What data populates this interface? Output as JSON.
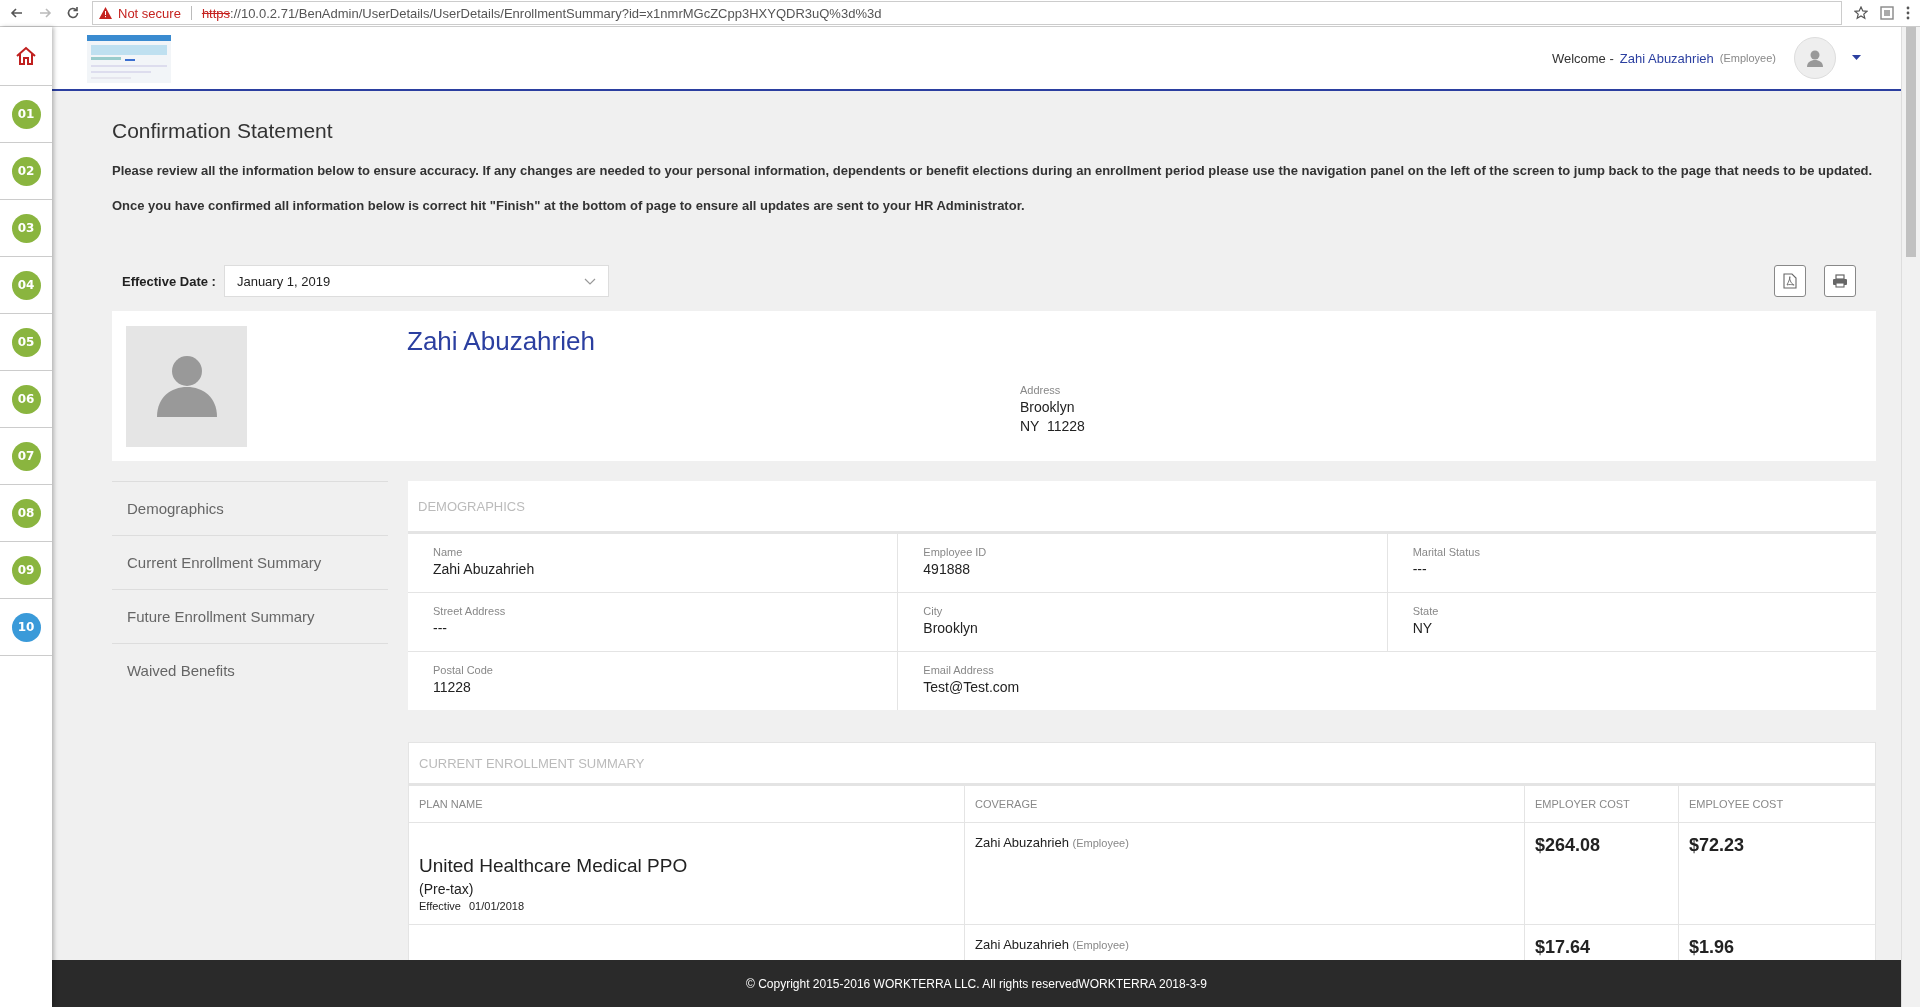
{
  "browser": {
    "security": "Not secure",
    "url_scheme": "https",
    "url_rest": "://10.0.2.71/BenAdmin/UserDetails/UserDetails/EnrollmentSummary?id=x1nmrMGcZCpp3HXYQDR3uQ%3d%3d"
  },
  "header": {
    "welcome": "Welcome -",
    "user": "Zahi Abuzahrieh",
    "role": "(Employee)"
  },
  "steps": [
    {
      "label": "01",
      "selected": false
    },
    {
      "label": "02",
      "selected": false
    },
    {
      "label": "03",
      "selected": false
    },
    {
      "label": "04",
      "selected": false
    },
    {
      "label": "05",
      "selected": false
    },
    {
      "label": "06",
      "selected": false
    },
    {
      "label": "07",
      "selected": false
    },
    {
      "label": "08",
      "selected": false
    },
    {
      "label": "09",
      "selected": false
    },
    {
      "label": "10",
      "selected": true
    }
  ],
  "title": "Confirmation Statement",
  "paragraphs": [
    "Please review all the information below to ensure accuracy.  If any changes are needed to your personal information, dependents or benefit elections during an enrollment period please use the navigation panel on the left of the screen to jump back to the page that needs to be updated.",
    "Once you have confirmed all information below is correct hit \"Finish\" at the bottom of page to ensure all updates are sent to your HR Administrator."
  ],
  "effective_date": {
    "label": "Effective Date :",
    "value": "January 1, 2019"
  },
  "profile": {
    "name": "Zahi Abuzahrieh",
    "address_label": "Address",
    "address_lines": [
      "Brooklyn",
      "NY  11228"
    ]
  },
  "section_menu": [
    {
      "label": "Demographics"
    },
    {
      "label": "Current Enrollment Summary"
    },
    {
      "label": "Future Enrollment Summary"
    },
    {
      "label": "Waived Benefits"
    }
  ],
  "demographics": {
    "title": "DEMOGRAPHICS",
    "rows": [
      [
        {
          "label": "Name",
          "value": "Zahi Abuzahrieh"
        },
        {
          "label": "Employee ID",
          "value": "491888"
        },
        {
          "label": "Marital Status",
          "value": "---"
        }
      ],
      [
        {
          "label": "Street Address",
          "value": "---"
        },
        {
          "label": "City",
          "value": "Brooklyn"
        },
        {
          "label": "State",
          "value": "NY"
        }
      ],
      [
        {
          "label": "Postal Code",
          "value": "11228"
        },
        {
          "label": "Email Address",
          "value": "Test@Test.com"
        }
      ]
    ]
  },
  "enrollment": {
    "title": "CURRENT ENROLLMENT SUMMARY",
    "columns": [
      "PLAN NAME",
      "COVERAGE",
      "EMPLOYER COST",
      "EMPLOYEE COST"
    ],
    "rows": [
      {
        "plan_name": "United Healthcare Medical PPO",
        "tax": "(Pre-tax)",
        "effective_label": "Effective",
        "effective_date": "01/01/2018",
        "coverage_name": "Zahi Abuzahrieh",
        "coverage_role": "(Employee)",
        "employer_cost": "$264.08",
        "employee_cost": "$72.23"
      },
      {
        "coverage_name": "Zahi Abuzahrieh",
        "coverage_role": "(Employee)",
        "employer_cost": "$17.64",
        "employee_cost": "$1.96"
      }
    ]
  },
  "footer": "© Copyright 2015-2016 WORKTERRA LLC. All rights reservedWORKTERRA 2018-3-9"
}
